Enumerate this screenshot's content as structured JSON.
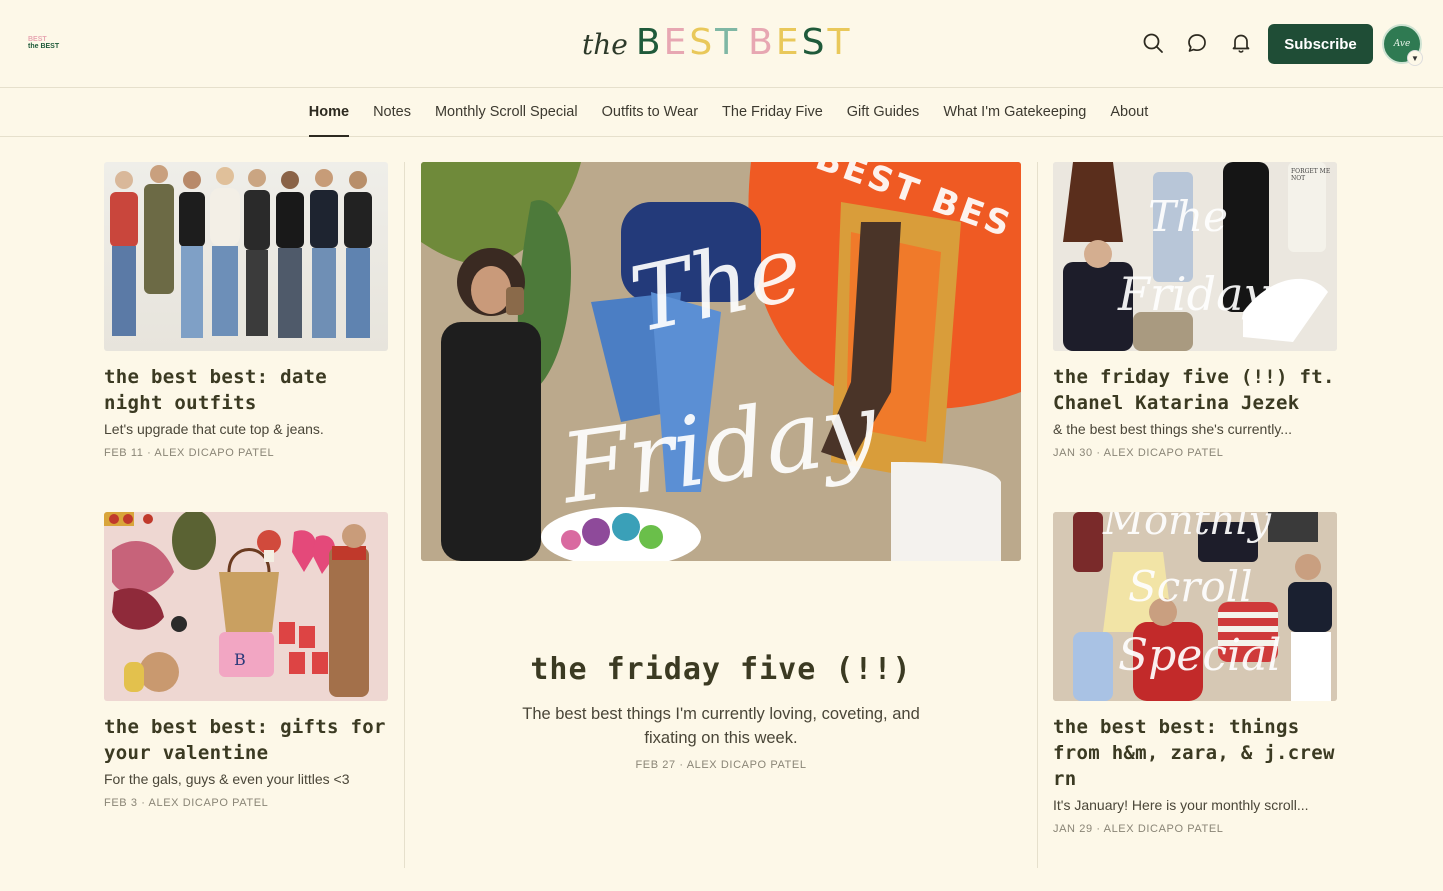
{
  "header": {
    "small_logo_line1": "BEST",
    "small_logo_line2": "the BEST",
    "logo_the": "the",
    "logo_word1": [
      "B",
      "E",
      "S",
      "T"
    ],
    "logo_word2": [
      "B",
      "E",
      "S",
      "T"
    ],
    "subscribe_label": "Subscribe",
    "avatar_initials": "Ave",
    "colors": {
      "logo_b": "#1f5a3a",
      "logo_e": "#e7a7b2",
      "logo_s": "#e9c85a",
      "logo_t": "#7fb7a4",
      "brand": "#1f4d36"
    }
  },
  "nav": {
    "items": [
      "Home",
      "Notes",
      "Monthly Scroll Special",
      "Outfits to Wear",
      "The Friday Five",
      "Gift Guides",
      "What I'm Gatekeeping",
      "About"
    ]
  },
  "posts": {
    "left1": {
      "title": "the best best: date night outfits",
      "subtitle": "Let's upgrade that cute top & jeans.",
      "meta": "FEB 11 · ALEX DICAPO PATEL"
    },
    "left2": {
      "title": "the best best: gifts for your valentine",
      "subtitle": "For the gals, guys & even your littles <3",
      "meta": "FEB 3 · ALEX DICAPO PATEL"
    },
    "hero": {
      "image_script_1": "The",
      "image_script_2": "Friday",
      "image_ring_text": "BEST BES",
      "title": "the friday five (!!)",
      "subtitle": "The best best things I'm currently loving, coveting, and fixating on this week.",
      "meta": "FEB 27 · ALEX DICAPO PATEL"
    },
    "right1": {
      "image_script_1": "The",
      "image_script_2": "Friday",
      "image_label": "FORGET ME NOT",
      "title": "the friday five (!!) ft. Chanel Katarina Jezek",
      "subtitle": "& the best best things she's currently...",
      "meta": "JAN 30 · ALEX DICAPO PATEL"
    },
    "right2": {
      "image_script_1": "Monthly",
      "image_script_2": "Scroll",
      "image_script_3": "Special",
      "title": "the best best: things from h&m, zara, & j.crew rn",
      "subtitle": "It's January! Here is your monthly scroll...",
      "meta": "JAN 29 · ALEX DICAPO PATEL"
    }
  }
}
